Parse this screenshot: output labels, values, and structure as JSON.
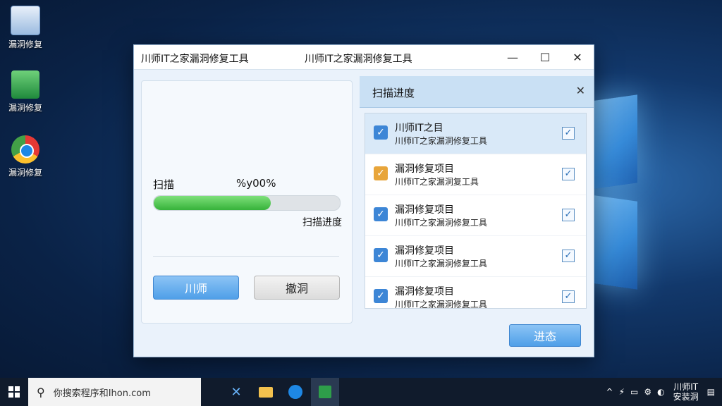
{
  "desktop": {
    "icons": [
      {
        "label": "漏洞修复",
        "icon": "document-icon"
      },
      {
        "label": "漏洞修复",
        "icon": "excel-icon"
      },
      {
        "label": "漏洞修复",
        "icon": "chrome-icon"
      }
    ]
  },
  "window": {
    "title_left": "川师IT之家漏洞修复工具",
    "title_center": "川师IT之家漏洞修复工具",
    "controls": {
      "minimize": "—",
      "maximize": "☐",
      "close": "✕"
    }
  },
  "scan": {
    "label": "扫描",
    "percent_text": "%y00%",
    "progress": 0.63,
    "caption": "扫描进度",
    "button_primary": "川师",
    "button_secondary": "撤洞"
  },
  "panel": {
    "title": "扫描进度",
    "close": "✕",
    "items": [
      {
        "title": "川师IT之目",
        "subtitle": "川师IT之家漏洞修复工具",
        "checked": true,
        "selected": true,
        "color": "#3d86d6"
      },
      {
        "title": "漏洞修复项目",
        "subtitle": "川师IT之家漏洞复工具",
        "checked": true,
        "selected": false,
        "color": "#e8a53a"
      },
      {
        "title": "漏洞修复项目",
        "subtitle": "川师IT之家漏洞修复工具",
        "checked": true,
        "selected": false,
        "color": "#3d86d6"
      },
      {
        "title": "漏洞修复项目",
        "subtitle": "川师IT之家漏洞修复工具",
        "checked": true,
        "selected": false,
        "color": "#3d86d6"
      },
      {
        "title": "漏洞修复项目",
        "subtitle": "川师IT之家漏洞修复工具",
        "checked": true,
        "selected": false,
        "color": "#3d86d6"
      }
    ],
    "next_button": "进态"
  },
  "taskbar": {
    "search_text": "你搜索程序和Ihon.com",
    "clock_line1": "川师IT",
    "clock_line2": "安装洞"
  }
}
